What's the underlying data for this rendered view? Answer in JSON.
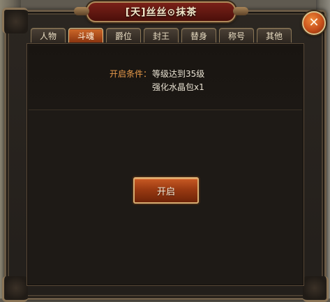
{
  "window": {
    "title": "[天]丝丝⊙抹茶",
    "close_glyph": "✕"
  },
  "tabs": [
    {
      "label": "人物",
      "active": false
    },
    {
      "label": "斗魂",
      "active": true
    },
    {
      "label": "爵位",
      "active": false
    },
    {
      "label": "封王",
      "active": false
    },
    {
      "label": "替身",
      "active": false
    },
    {
      "label": "称号",
      "active": false
    },
    {
      "label": "其他",
      "active": false
    }
  ],
  "requirement": {
    "label": "开启条件：",
    "level": "等级达到35级",
    "item": "强化水晶包x1"
  },
  "open_button": {
    "label": "开启"
  },
  "colors": {
    "active_tab": "#d06a2a",
    "requirement_label": "#e79a4a",
    "title_plate": "#7a2118"
  }
}
